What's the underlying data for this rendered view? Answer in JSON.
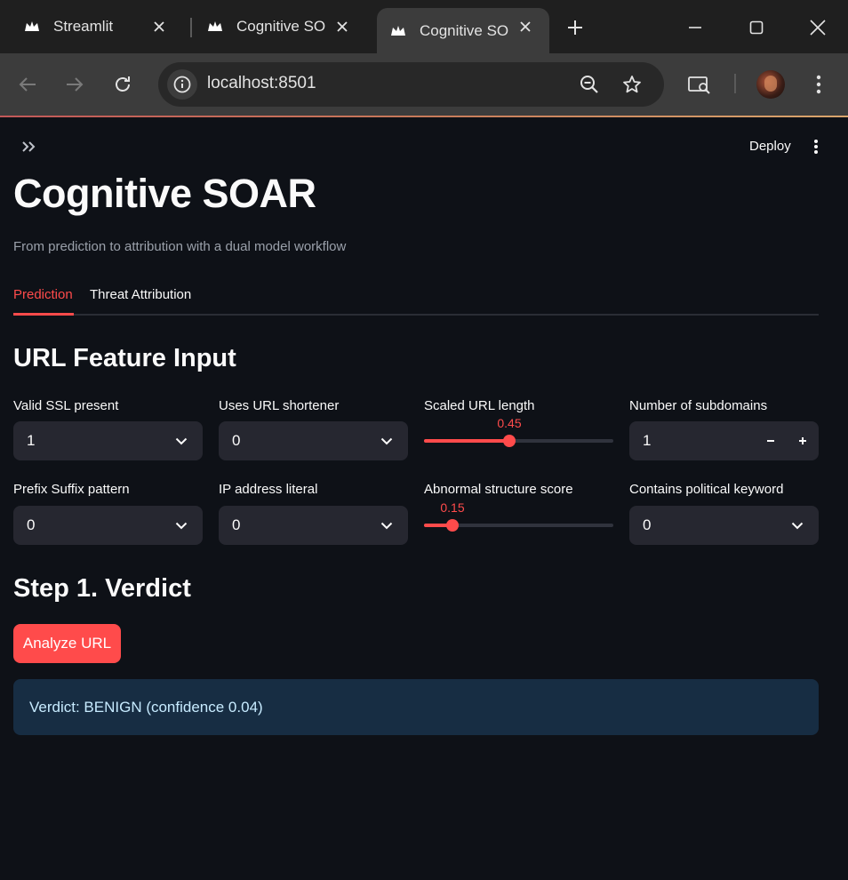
{
  "browser": {
    "tabs": [
      {
        "title": "Streamlit",
        "active": false
      },
      {
        "title": "Cognitive SOAR",
        "active": false
      },
      {
        "title": "Cognitive SOAR",
        "active": true
      }
    ],
    "url": "localhost:8501"
  },
  "app": {
    "header": {
      "deploy_label": "Deploy"
    },
    "title": "Cognitive SOAR",
    "subtitle": "From prediction to attribution with a dual model workflow",
    "tabs": [
      {
        "label": "Prediction",
        "active": true
      },
      {
        "label": "Threat Attribution",
        "active": false
      }
    ],
    "feature_section": {
      "heading": "URL Feature Input",
      "fields": [
        {
          "label": "Valid SSL present",
          "type": "select",
          "value": "1"
        },
        {
          "label": "Uses URL shortener",
          "type": "select",
          "value": "0"
        },
        {
          "label": "Scaled URL length",
          "type": "slider",
          "value": "0.45",
          "level": 0.45
        },
        {
          "label": "Number of subdomains",
          "type": "number",
          "value": "1"
        },
        {
          "label": "Prefix Suffix pattern",
          "type": "select",
          "value": "0"
        },
        {
          "label": "IP address literal",
          "type": "select",
          "value": "0"
        },
        {
          "label": "Abnormal structure score",
          "type": "slider",
          "value": "0.15",
          "level": 0.15
        },
        {
          "label": "Contains political keyword",
          "type": "select",
          "value": "0"
        }
      ]
    },
    "verdict_section": {
      "heading": "Step 1. Verdict",
      "button_label": "Analyze URL",
      "result_text": "Verdict: BENIGN (confidence 0.04)"
    }
  },
  "colors": {
    "accent": "#ff4b4b",
    "background": "#0e1117",
    "widget_bg": "#262730",
    "info_bg": "#172d43",
    "info_text": "#c7ebff"
  }
}
